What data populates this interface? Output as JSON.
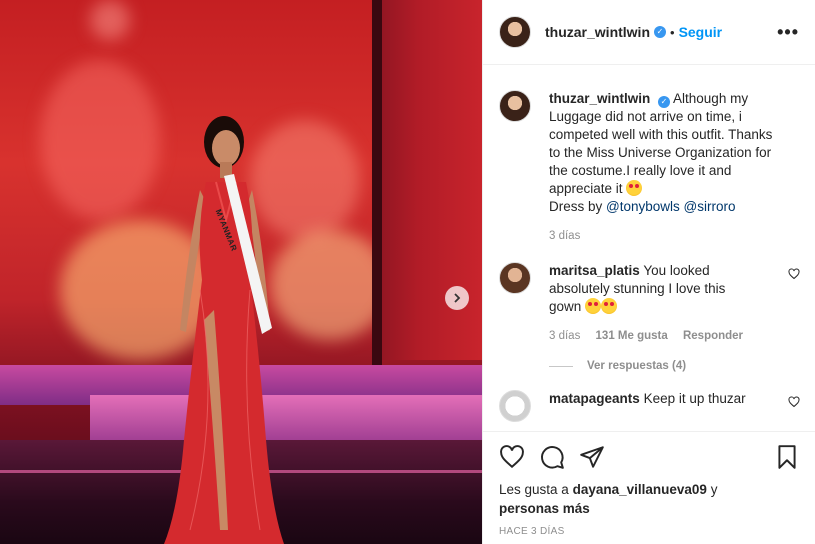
{
  "post": {
    "username": "thuzar_wintlwin",
    "follow_label": "Seguir",
    "more_label": "•••"
  },
  "caption": {
    "username": "thuzar_wintlwin",
    "text_1": "Although my Luggage did not arrive on time, i competed well with this outfit. Thanks to the Miss Universe Organization for the costume.I really love it and appreciate it",
    "text_2": "Dress by",
    "mention_1": "@tonybowls",
    "mention_2": "@sirroro",
    "time": "3 días"
  },
  "comments": [
    {
      "username": "maritsa_platis",
      "text": "You looked absolutely stunning I love this gown",
      "time": "3 días",
      "likes": "131 Me gusta",
      "reply_label": "Responder",
      "view_replies": "Ver respuestas (4)"
    },
    {
      "username": "matapageants",
      "text": "Keep it up thuzar"
    }
  ],
  "photo": {
    "sash_text": "MYANMAR"
  },
  "likes": {
    "prefix": "Les gusta a",
    "user": "dayana_villanueva09",
    "suffix": "y",
    "others": "personas más"
  },
  "post_time": "HACE 3 DÍAS",
  "colors": {
    "accent": "#0095f6",
    "verified": "#3897f0",
    "muted": "#8e8e8e"
  },
  "icons": [
    "heart-icon",
    "comment-icon",
    "share-icon",
    "bookmark-icon",
    "chevron-right-icon",
    "verified-icon"
  ]
}
